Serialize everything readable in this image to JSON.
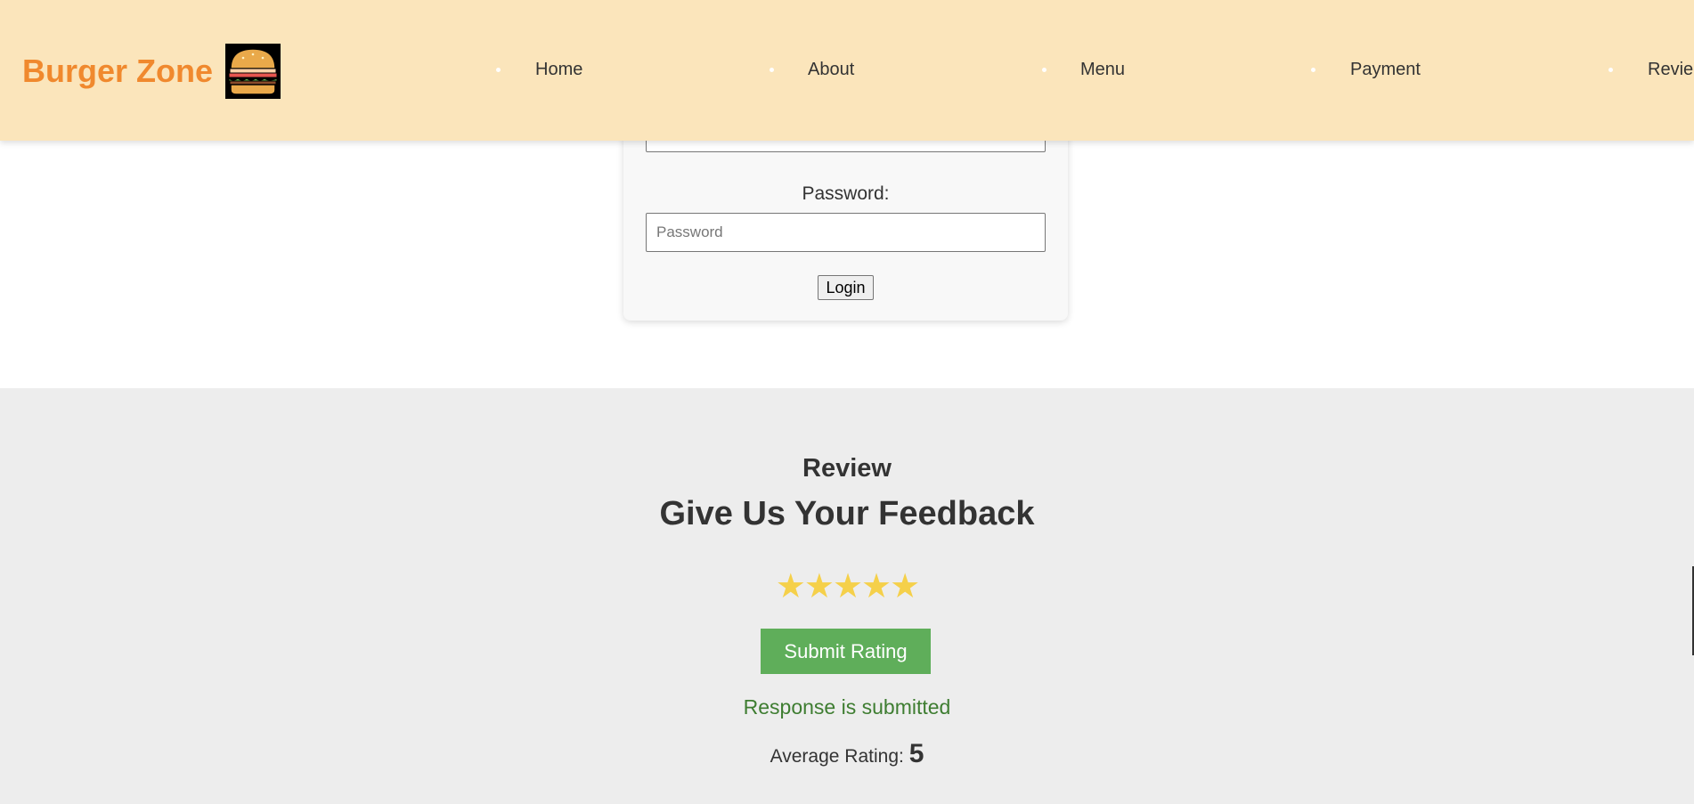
{
  "brand": {
    "name": "Burger Zone",
    "accent_color": "#f0892e",
    "logo_icon": "burger-icon"
  },
  "header": {
    "background": "#fbe5bb"
  },
  "nav": {
    "items": [
      {
        "label": "Home"
      },
      {
        "label": "About"
      },
      {
        "label": "Menu"
      },
      {
        "label": "Payment"
      },
      {
        "label": "Revie"
      }
    ]
  },
  "login": {
    "password_label": "Password:",
    "password_placeholder": "Password",
    "login_label": "Login"
  },
  "review": {
    "subtitle": "Review",
    "title": "Give Us Your Feedback",
    "stars": [
      "★",
      "★",
      "★",
      "★",
      "★"
    ],
    "star_color": "#f5d04a",
    "submit_label": "Submit Rating",
    "submit_color": "#5fae5a",
    "response_text": "Response is submitted",
    "average_label": "Average Rating:",
    "average_value": "5"
  }
}
